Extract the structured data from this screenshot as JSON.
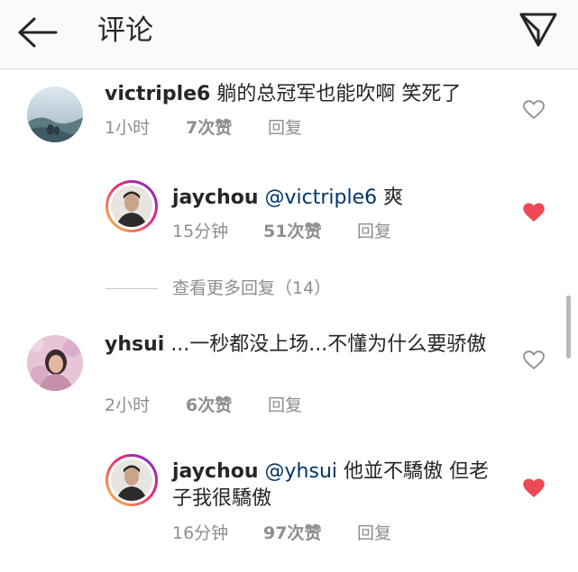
{
  "header": {
    "title": "评论"
  },
  "comments": [
    {
      "username": "victriple6",
      "text": "躺的总冠军也能吹啊  笑死了",
      "time": "1小时",
      "likes": "7次赞",
      "reply": "回复",
      "liked": false
    },
    {
      "username": "jaychou",
      "mention": "@victriple6",
      "text": "爽",
      "time": "15分钟",
      "likes": "51次赞",
      "reply": "回复",
      "liked": true
    },
    {
      "username": "yhsui",
      "text": "...一秒都没上场...不懂为什么要骄傲",
      "time": "2小时",
      "likes": "6次赞",
      "reply": "回复",
      "liked": false
    },
    {
      "username": "jaychou",
      "mention": "@yhsui",
      "text": "他並不驕傲 但老子我很驕傲",
      "time": "16分钟",
      "likes": "97次赞",
      "reply": "回复",
      "liked": true
    }
  ],
  "view_more_replies": "查看更多回复（14）",
  "colors": {
    "heart_liked": "#ed4956",
    "mention": "#003569",
    "meta": "#8e8e8e",
    "header_bg": "#fafafa"
  },
  "icons": {
    "back": "arrow-left-icon",
    "send": "paper-plane-icon",
    "like": "heart-icon"
  }
}
